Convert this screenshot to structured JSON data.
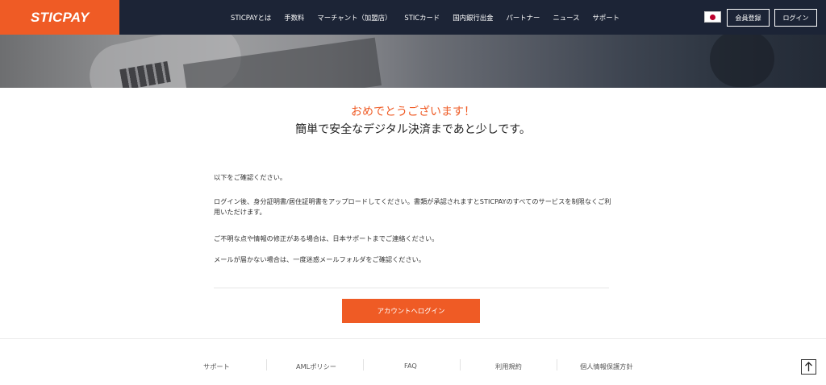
{
  "header": {
    "logo": "STICPAY",
    "nav": [
      "STICPAYとは",
      "手数料",
      "マーチャント（加盟店）",
      "STICカード",
      "国内銀行出金",
      "パートナー",
      "ニュース",
      "サポート"
    ],
    "register_label": "会員登録",
    "login_label": "ログイン",
    "flag_icon": "japan-flag-icon"
  },
  "main": {
    "congrats": "おめでとうございます！",
    "subtitle": "簡単で安全なデジタル決済まであと少しです。",
    "paragraphs": [
      "以下をご確認ください。",
      "ログイン後、身分証明書/居住証明書をアップロードしてください。書類が承認されますとSTICPAYのすべてのサービスを制限なくご利用いただけます。",
      "ご不明な点や情報の修正がある場合は、日本サポートまでご連絡ください。",
      "メールが届かない場合は、一度迷惑メールフォルダをご確認ください。"
    ],
    "cta_label": "アカウントへログイン"
  },
  "footer": {
    "links": [
      "サポート",
      "AMLポリシー",
      "FAQ",
      "利用規約",
      "個人情報保護方針"
    ],
    "top_icon": "arrow-up-icon"
  },
  "colors": {
    "accent": "#ef5b25",
    "header_bg": "#1c2436"
  }
}
